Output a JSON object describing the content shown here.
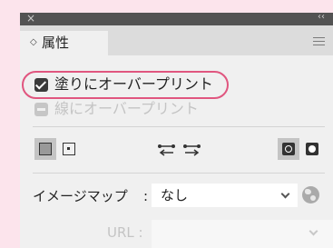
{
  "window": {
    "close_glyph": "×",
    "collapse_glyph": "‹‹"
  },
  "tab": {
    "glyph": "◇",
    "label": "属性"
  },
  "options": {
    "fill_overprint": {
      "label": "塗りにオーバープリント",
      "checked": true
    },
    "stroke_overprint": {
      "label": "線にオーバープリント",
      "enabled": false
    }
  },
  "image_map": {
    "label": "イメージマップ",
    "colon": ":",
    "value": "なし"
  },
  "url": {
    "label": "URL :",
    "value": ""
  },
  "colors": {
    "highlight": "#e0567f",
    "background": "#fce4ec"
  }
}
